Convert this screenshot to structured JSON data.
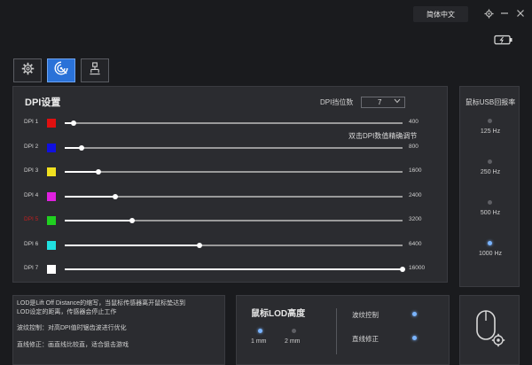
{
  "window": {
    "language": "简体中文"
  },
  "tabs": [
    {
      "icon": "gear-icon"
    },
    {
      "icon": "target-icon"
    },
    {
      "icon": "macro-icon"
    }
  ],
  "dpi": {
    "title": "DPI设置",
    "count_label": "DPI挡位数",
    "count_value": "7",
    "hint": "双击DPI数值精确调节",
    "max_dpi": 16000,
    "rows": [
      {
        "label": "DPI 1",
        "color": "#e01010",
        "value": "400",
        "active": false
      },
      {
        "label": "DPI 2",
        "color": "#1010e0",
        "value": "800",
        "active": false
      },
      {
        "label": "DPI 3",
        "color": "#f0e020",
        "value": "1600",
        "active": false
      },
      {
        "label": "DPI 4",
        "color": "#e020e0",
        "value": "2400",
        "active": false
      },
      {
        "label": "DPI 5",
        "color": "#20d020",
        "value": "3200",
        "active": true
      },
      {
        "label": "DPI 6",
        "color": "#20e0e0",
        "value": "6400",
        "active": false
      },
      {
        "label": "DPI 7",
        "color": "#ffffff",
        "value": "16000",
        "active": false
      }
    ]
  },
  "polling": {
    "title": "鼠标USB回报率",
    "options": [
      {
        "label": "125 Hz",
        "selected": false
      },
      {
        "label": "250 Hz",
        "selected": false
      },
      {
        "label": "500 Hz",
        "selected": false
      },
      {
        "label": "1000 Hz",
        "selected": true
      }
    ]
  },
  "info": {
    "lines": [
      "LOD是Lift Off Distance的缩写，当鼠标传感器离开鼠标垫达到",
      "LOD设定的距离，传感器会停止工作",
      "波纹控制：对高DPI值时锯齿波进行优化",
      "直线修正：画直线比较直，适合狙击游戏"
    ]
  },
  "lod": {
    "title": "鼠标LOD高度",
    "options": [
      {
        "label": "1 mm",
        "selected": true
      },
      {
        "label": "2 mm",
        "selected": false
      }
    ],
    "toggles": [
      {
        "label": "波纹控制",
        "on": true
      },
      {
        "label": "直线修正",
        "on": true
      }
    ]
  },
  "accent_color": "#2a72d8"
}
